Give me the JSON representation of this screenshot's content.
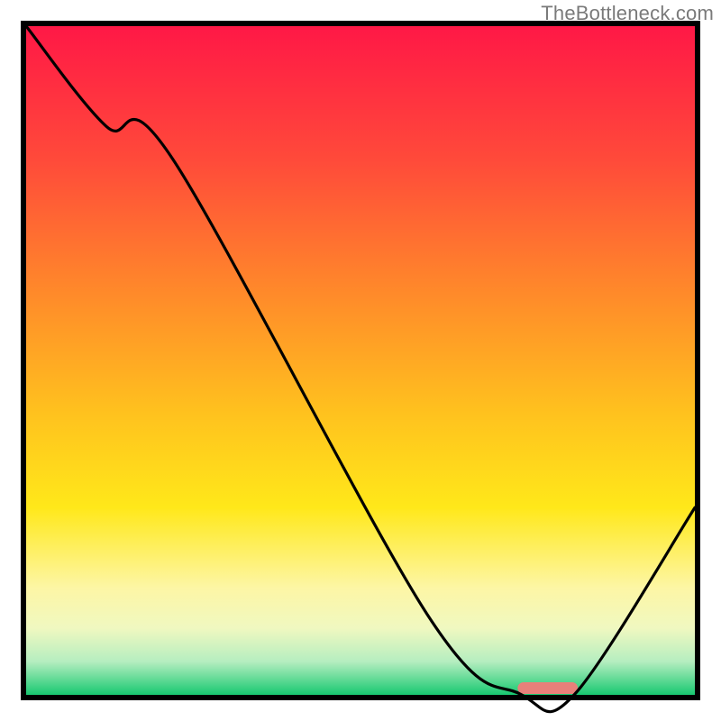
{
  "watermark": "TheBottleneck.com",
  "chart_data": {
    "type": "line",
    "title": "",
    "xlabel": "",
    "ylabel": "",
    "xlim": [
      0,
      100
    ],
    "ylim": [
      0,
      100
    ],
    "grid": false,
    "legend": false,
    "x": [
      0,
      12,
      22,
      60,
      74,
      82,
      100
    ],
    "values": [
      100,
      85,
      80,
      12,
      0,
      0,
      28
    ],
    "curve_note": "Black curve: starts top-left, slight knee near x≈22, near-linear fall to the valley floor around x≈74–82, then rises toward right edge. Y=0 is the green baseline; Y=100 is the top of the plot.",
    "background_gradient": {
      "direction": "vertical",
      "stops": [
        {
          "pos": 0.0,
          "color": "#ff1846"
        },
        {
          "pos": 0.2,
          "color": "#ff4a3a"
        },
        {
          "pos": 0.4,
          "color": "#ff8a2a"
        },
        {
          "pos": 0.58,
          "color": "#ffc21e"
        },
        {
          "pos": 0.72,
          "color": "#ffe81a"
        },
        {
          "pos": 0.84,
          "color": "#fdf6a5"
        },
        {
          "pos": 0.9,
          "color": "#f0f8c0"
        },
        {
          "pos": 0.95,
          "color": "#b6eec0"
        },
        {
          "pos": 1.0,
          "color": "#18c871"
        }
      ]
    },
    "marker": {
      "shape": "rounded-bar",
      "x_center": 78,
      "width": 9,
      "color": "#e8807a"
    }
  }
}
